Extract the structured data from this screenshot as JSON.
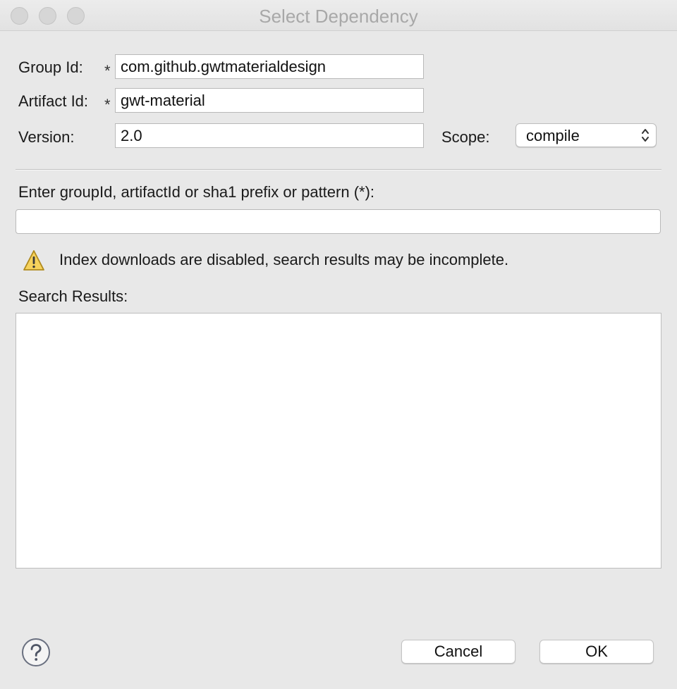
{
  "window": {
    "title": "Select Dependency"
  },
  "form": {
    "group_id_label": "Group Id:",
    "group_id_value": "com.github.gwtmaterialdesign",
    "artifact_id_label": "Artifact Id:",
    "artifact_id_value": "gwt-material",
    "version_label": "Version:",
    "version_value": "2.0",
    "scope_label": "Scope:",
    "scope_value": "compile",
    "required_marker": "*"
  },
  "search": {
    "prompt_label": "Enter groupId, artifactId or sha1 prefix or pattern (*):",
    "query_value": "",
    "warning_icon": "warning-icon",
    "warning_text": "Index downloads are disabled, search results may be incomplete.",
    "results_label": "Search Results:",
    "results": []
  },
  "footer": {
    "help_icon": "help-icon",
    "cancel_label": "Cancel",
    "ok_label": "OK"
  }
}
